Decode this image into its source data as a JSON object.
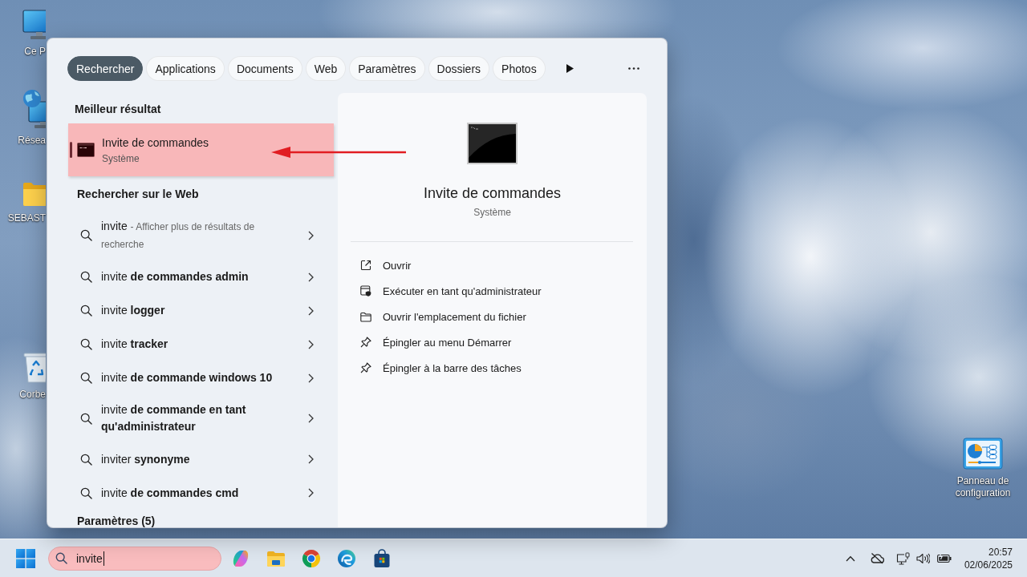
{
  "desktop": {
    "icons": [
      {
        "kind": "computer",
        "label": "Ce P"
      },
      {
        "kind": "network",
        "label": "Résea"
      },
      {
        "kind": "folder",
        "label": "SEBAST"
      },
      {
        "kind": "recycle",
        "label": "Corbe"
      },
      {
        "kind": "control",
        "label": "Panneau de configuration"
      }
    ]
  },
  "search_panel": {
    "filters": [
      {
        "label": "Rechercher",
        "selected": true
      },
      {
        "label": "Applications",
        "selected": false
      },
      {
        "label": "Documents",
        "selected": false
      },
      {
        "label": "Web",
        "selected": false
      },
      {
        "label": "Paramètres",
        "selected": false
      },
      {
        "label": "Dossiers",
        "selected": false
      },
      {
        "label": "Photos",
        "selected": false
      }
    ],
    "best_match": {
      "heading": "Meilleur résultat",
      "title": "Invite de commandes",
      "subtitle": "Système",
      "selected": true,
      "highlighted": true
    },
    "web_search": {
      "heading": "Rechercher sur le Web",
      "suggestions": [
        {
          "text": "invite",
          "hint": "- Afficher plus de résultats de recherche"
        },
        {
          "text": "invite **de commandes admin**"
        },
        {
          "text": "invite **logger**"
        },
        {
          "text": "invite **tracker**"
        },
        {
          "text": "invite **de commande windows 10**"
        },
        {
          "text": "invite **de commande en tant qu'administrateur**"
        },
        {
          "text": "inviter **synonyme**"
        },
        {
          "text": "invite **de commandes cmd**"
        }
      ]
    },
    "settings_section": {
      "heading": "Paramètres (5)"
    },
    "details": {
      "title": "Invite de commandes",
      "subtitle": "Système",
      "actions": [
        {
          "kind": "open",
          "label": "Ouvrir"
        },
        {
          "kind": "admin",
          "label": "Exécuter en tant qu'administrateur"
        },
        {
          "kind": "folder",
          "label": "Ouvrir l'emplacement du fichier"
        },
        {
          "kind": "pin",
          "label": "Épingler au menu Démarrer"
        },
        {
          "kind": "pin",
          "label": "Épingler à la barre des tâches"
        }
      ]
    }
  },
  "taskbar": {
    "search": {
      "value": "invite",
      "highlighted": true
    },
    "clock": {
      "time": "20:57",
      "date": "02/06/2025"
    }
  }
}
